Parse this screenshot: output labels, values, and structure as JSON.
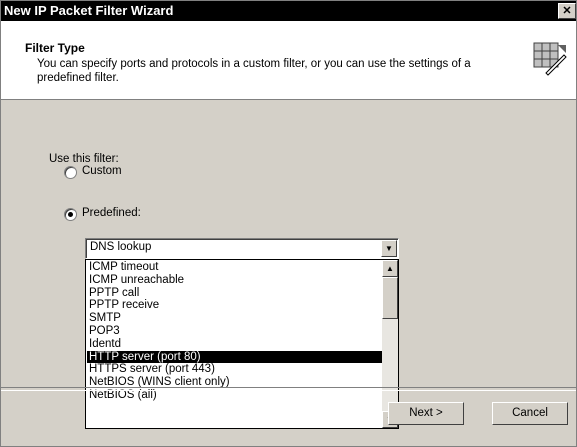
{
  "window": {
    "title": "New IP Packet Filter Wizard",
    "close_glyph": "✕"
  },
  "header": {
    "title": "Filter Type",
    "description": "You can specify ports and protocols in a custom filter, or you can use the settings of a predefined filter.",
    "icon": "wizard-filter-icon"
  },
  "body": {
    "use_filter_label": "Use this filter:",
    "options": [
      {
        "label": "Custom",
        "selected": false
      },
      {
        "label": "Predefined:",
        "selected": true
      }
    ]
  },
  "combo": {
    "value": "DNS lookup"
  },
  "list": {
    "items": [
      "ICMP timeout",
      "ICMP unreachable",
      "PPTP call",
      "PPTP receive",
      "SMTP",
      "POP3",
      "Identd",
      "HTTP server (port 80)",
      "HTTPS server (port 443)",
      "NetBIOS (WINS client only)",
      "NetBIOS (all)"
    ],
    "selected_index": 7
  },
  "buttons": {
    "next": "Next >",
    "cancel": "Cancel"
  }
}
